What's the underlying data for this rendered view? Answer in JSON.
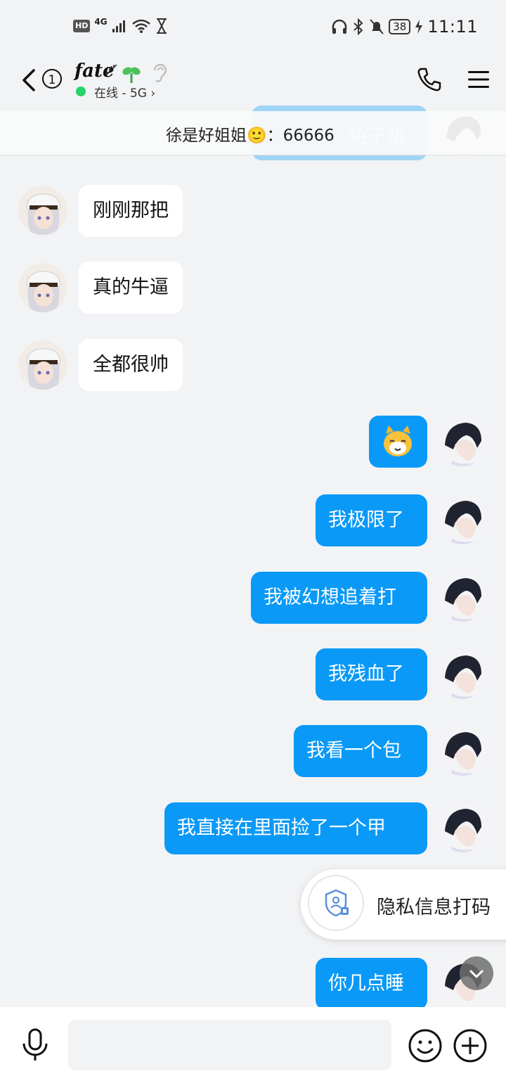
{
  "status_bar": {
    "hd": "HD",
    "network": "4G",
    "battery": "38",
    "time": "11:11"
  },
  "header": {
    "unread_count": "1",
    "contact_name": "fate",
    "online_status": "在线 - 5G",
    "online_color": "#25d366"
  },
  "pinned": {
    "sender": "徐是好姐姐",
    "emoji": "🙂",
    "separator": "：",
    "text": "66666",
    "overlap_text": "兔子跳"
  },
  "messages": [
    {
      "side": "in",
      "text": "刚刚那把"
    },
    {
      "side": "in",
      "text": "真的牛逼"
    },
    {
      "side": "in",
      "text": "全都很帅"
    },
    {
      "side": "out",
      "text": "",
      "sticker": "cat-sticker"
    },
    {
      "side": "out",
      "text": "我极限了"
    },
    {
      "side": "out",
      "text": "我被幻想追着打"
    },
    {
      "side": "out",
      "text": "我残血了"
    },
    {
      "side": "out",
      "text": "我看一个包"
    },
    {
      "side": "out",
      "text": "我直接在里面捡了一个甲"
    },
    {
      "side": "out",
      "text": "你几点睡"
    }
  ],
  "privacy_toast": {
    "label": "隐私信息打码"
  },
  "input": {
    "value": "",
    "placeholder": ""
  },
  "colors": {
    "bubble_out": "#0a99f7",
    "bubble_in": "#ffffff",
    "background": "#f2f3f5"
  }
}
